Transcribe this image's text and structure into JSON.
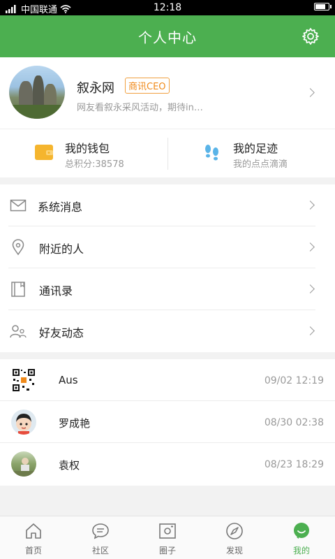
{
  "status_bar": {
    "carrier": "中国联通",
    "time": "12:18"
  },
  "header": {
    "title": "个人中心",
    "settings_icon": "gear-icon"
  },
  "profile": {
    "name": "叙永网",
    "badge": "商讯CEO",
    "subtitle": "网友看叙永采风活动，期待in…"
  },
  "wallet": {
    "title": "我的钱包",
    "sub": "总积分:38578",
    "icon": "wallet-icon"
  },
  "footprint": {
    "title": "我的足迹",
    "sub": "我的点点滴滴",
    "icon": "footprint-icon"
  },
  "menu": [
    {
      "label": "系统消息",
      "icon": "mail-icon"
    },
    {
      "label": "附近的人",
      "icon": "location-pin-icon"
    },
    {
      "label": "通讯录",
      "icon": "contacts-book-icon"
    },
    {
      "label": "好友动态",
      "icon": "friends-icon"
    }
  ],
  "chats": [
    {
      "name": "Aus",
      "time": "09/02 12:19",
      "avatar": "qr-code-avatar"
    },
    {
      "name": "罗成艳",
      "time": "08/30 02:38",
      "avatar": "cartoon-avatar"
    },
    {
      "name": "袁权",
      "time": "08/23 18:29",
      "avatar": "photo-avatar"
    }
  ],
  "bottom_nav": [
    {
      "label": "首页",
      "icon": "home-icon",
      "active": false
    },
    {
      "label": "社区",
      "icon": "chat-bubble-icon",
      "active": false
    },
    {
      "label": "圈子",
      "icon": "camera-frame-icon",
      "active": false
    },
    {
      "label": "发现",
      "icon": "compass-icon",
      "active": false
    },
    {
      "label": "我的",
      "icon": "profile-face-icon",
      "active": true
    }
  ],
  "colors": {
    "primary_green": "#4caf50",
    "badge_orange": "#f08a1a",
    "wallet_yellow": "#f5b52e",
    "footprint_blue": "#5ab4e8"
  }
}
